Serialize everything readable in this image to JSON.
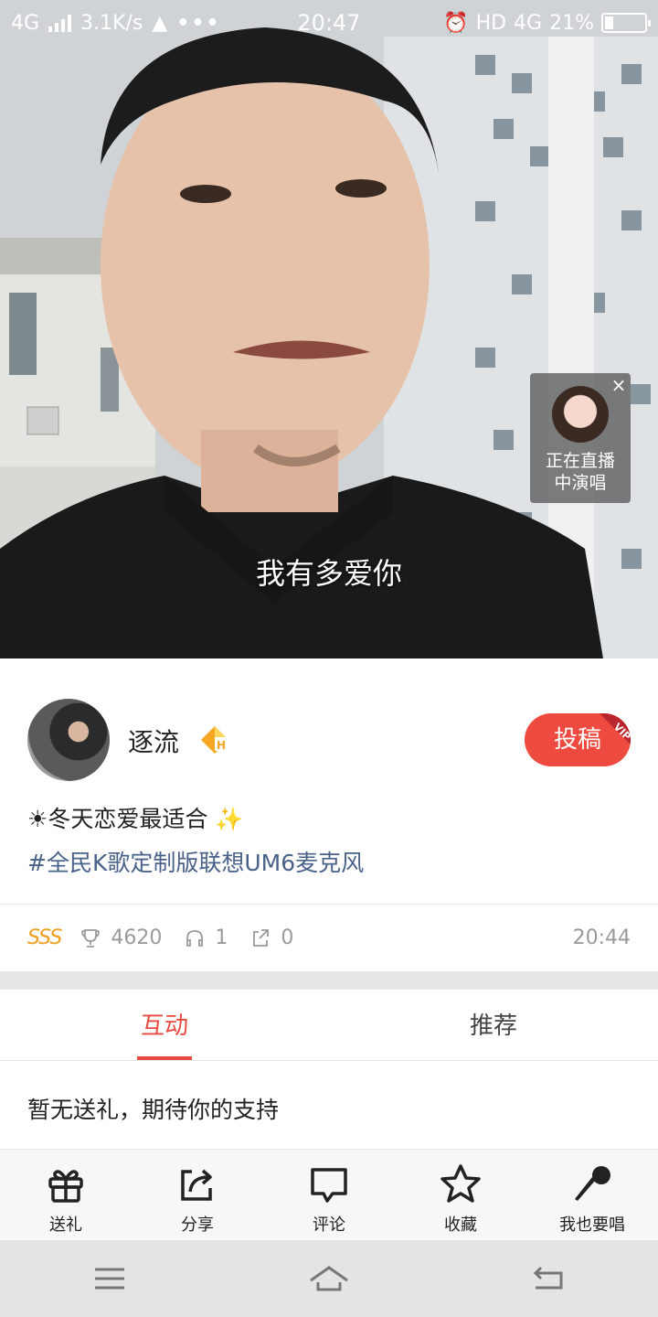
{
  "status_bar": {
    "network": "4G",
    "speed": "3.1K/s",
    "time": "20:47",
    "hd_label": "HD",
    "network_right": "4G",
    "battery": "21%",
    "battery_level": 0.21
  },
  "player": {
    "lyric": "我有多爱你",
    "live_card": {
      "close": "×",
      "line1": "正在直播",
      "line2": "中演唱"
    }
  },
  "profile": {
    "username": "逐流",
    "submit_button": "投稿",
    "vip_label": "VIP",
    "caption": "☀冬天恋爱最适合 ✨",
    "tagline": "#全民K歌定制版联想UM6麦克风"
  },
  "stats": {
    "grade": "SSS",
    "trophy_count": "4620",
    "listen_count": "1",
    "share_count": "0",
    "time": "20:44"
  },
  "tabs": [
    {
      "label": "互动",
      "active": true
    },
    {
      "label": "推荐",
      "active": false
    }
  ],
  "gifts": {
    "empty_text": "暂无送礼，期待你的支持"
  },
  "actions": [
    {
      "label": "送礼",
      "icon": "gift-icon"
    },
    {
      "label": "分享",
      "icon": "share-icon"
    },
    {
      "label": "评论",
      "icon": "comment-icon"
    },
    {
      "label": "收藏",
      "icon": "star-icon"
    },
    {
      "label": "我也要唱",
      "icon": "microphone-icon"
    }
  ],
  "colors": {
    "accent": "#e94a3f",
    "tag": "#4a6189",
    "grade": "#f0a020"
  }
}
